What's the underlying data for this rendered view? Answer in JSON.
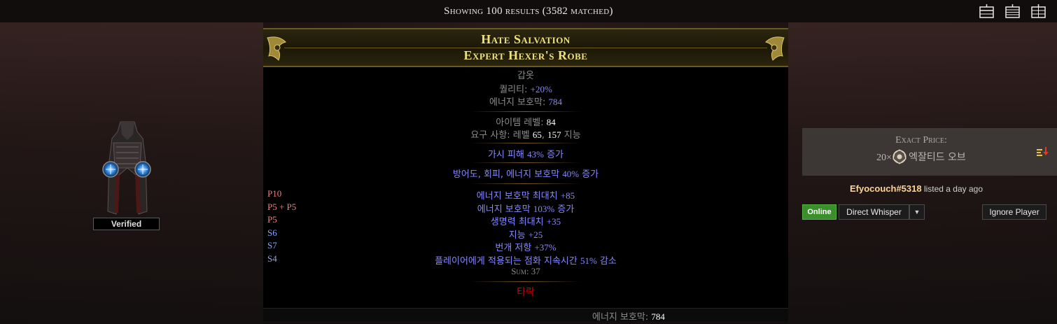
{
  "topbar": {
    "results_text": "Showing 100 results (3582 matched)",
    "layout_icons": [
      "layout-list-icon",
      "layout-compact-icon",
      "layout-columns-icon"
    ]
  },
  "listing": {
    "verified_label": "Verified",
    "item": {
      "name": "Hate Salvation",
      "base_type": "Expert Hexer's Robe",
      "category": "갑옷",
      "quality_label": "퀄리티: ",
      "quality_value": "+20%",
      "es_label": "에너지 보호막: ",
      "es_value": "784",
      "ilvl_label": "아이템 레벨: ",
      "ilvl_value": "84",
      "req_label": "요구 사항: 레벨 ",
      "req_level": "65",
      "req_sep": ", ",
      "req_int": "157",
      "req_int_label": " 지능",
      "implicit_1_pre": "가시 피해 ",
      "implicit_1_num": "43%",
      "implicit_1_post": " 증가",
      "enchant_pre": "방어도, 회피, 에너지 보호막 ",
      "enchant_num": "40%",
      "enchant_post": " 증가",
      "explicit_mods": [
        {
          "tier": "P10",
          "tier_type": "p",
          "pre": "에너지 보호막 최대치 ",
          "num": "+85",
          "post": ""
        },
        {
          "tier": "P5 + P5",
          "tier_type": "p",
          "pre": "에너지 보호막 ",
          "num": "103%",
          "post": " 증가"
        },
        {
          "tier": "P5",
          "tier_type": "p",
          "pre": "생명력 최대치 ",
          "num": "+35",
          "post": ""
        },
        {
          "tier": "S6",
          "tier_type": "s",
          "pre": "지능 ",
          "num": "+25",
          "post": ""
        },
        {
          "tier": "S7",
          "tier_type": "s",
          "pre": "번개 저항 ",
          "num": "+37%",
          "post": ""
        },
        {
          "tier": "S4",
          "tier_type": "s",
          "pre": "플레이어에게 적용되는 점화 지속시간 ",
          "num": "51%",
          "post": " 감소"
        }
      ],
      "sum_text": "Sum: 37",
      "corrupted": "타락",
      "footer_label": "에너지 보호막: ",
      "footer_value": "784"
    },
    "price": {
      "label": "Exact Price:",
      "amount": "20×",
      "currency": "엑잘티드 오브",
      "currency_icon": "exalted-orb-icon"
    },
    "seller": {
      "account": "Efyocouch#5318",
      "listed": "listed a day ago"
    },
    "buttons": {
      "online": "Online",
      "whisper": "Direct Whisper",
      "caret": "▼",
      "ignore": "Ignore Player"
    }
  },
  "colors": {
    "unique_name": "#efe27a",
    "magic_blue": "#8888ff",
    "prefix_tier": "#e88080",
    "suffix_tier": "#8aa4ff",
    "corrupted": "#d20000",
    "online_green": "#3a8e2b",
    "account_name": "#ffd590"
  }
}
